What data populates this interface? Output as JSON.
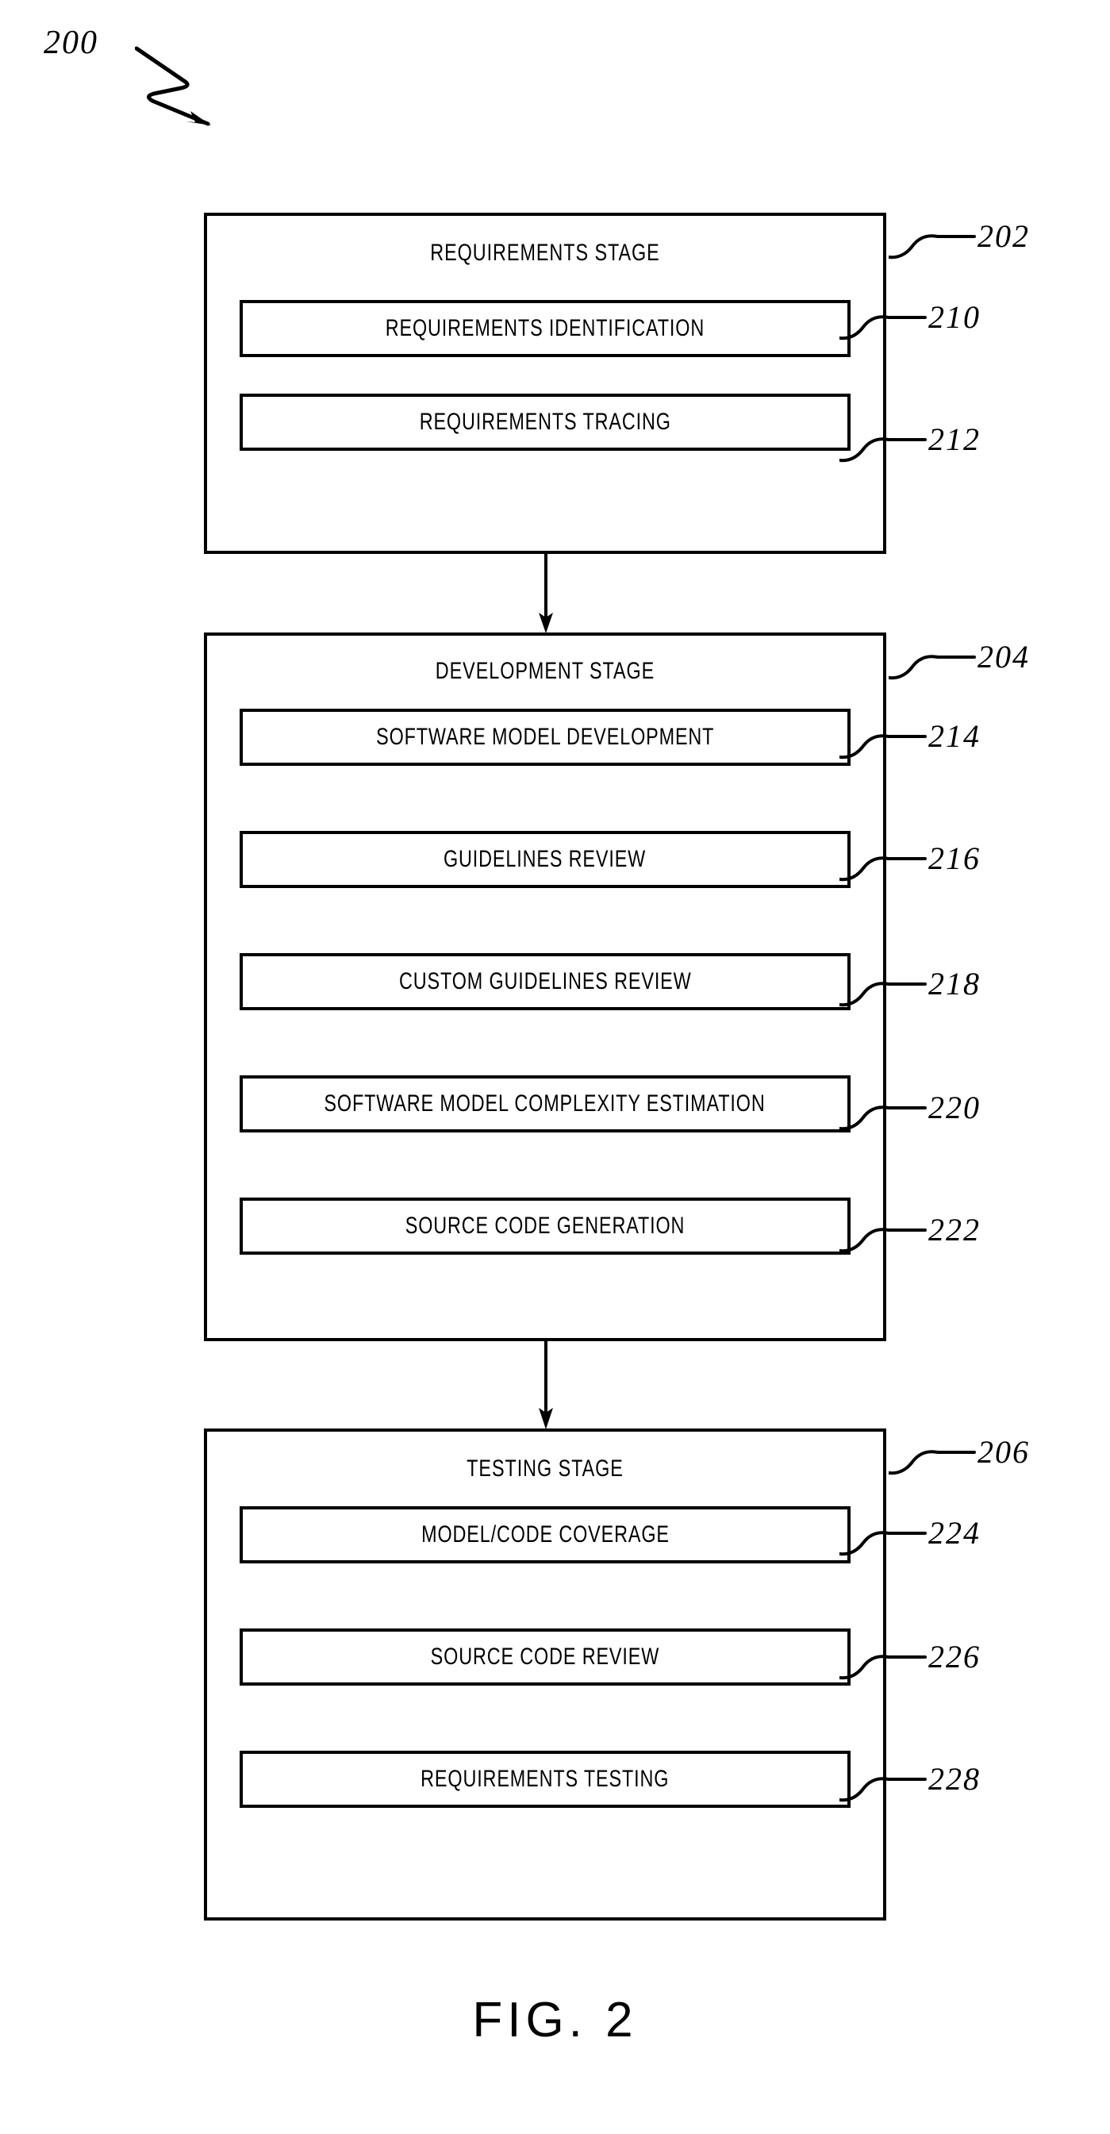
{
  "figure": {
    "number_label": "200",
    "caption": "FIG. 2"
  },
  "stages": [
    {
      "id": "requirements",
      "title": "REQUIREMENTS STAGE",
      "ref": "202",
      "steps": [
        {
          "label": "REQUIREMENTS IDENTIFICATION",
          "ref": "210"
        },
        {
          "label": "REQUIREMENTS TRACING",
          "ref": "212"
        }
      ]
    },
    {
      "id": "development",
      "title": "DEVELOPMENT STAGE",
      "ref": "204",
      "steps": [
        {
          "label": "SOFTWARE MODEL DEVELOPMENT",
          "ref": "214"
        },
        {
          "label": "GUIDELINES REVIEW",
          "ref": "216"
        },
        {
          "label": "CUSTOM GUIDELINES REVIEW",
          "ref": "218"
        },
        {
          "label": "SOFTWARE MODEL COMPLEXITY ESTIMATION",
          "ref": "220"
        },
        {
          "label": "SOURCE CODE GENERATION",
          "ref": "222"
        }
      ]
    },
    {
      "id": "testing",
      "title": "TESTING STAGE",
      "ref": "206",
      "steps": [
        {
          "label": "MODEL/CODE COVERAGE",
          "ref": "224"
        },
        {
          "label": "SOURCE CODE REVIEW",
          "ref": "226"
        },
        {
          "label": "REQUIREMENTS TESTING",
          "ref": "228"
        }
      ]
    }
  ],
  "colors": {
    "ink": "#000000",
    "paper": "#ffffff"
  }
}
